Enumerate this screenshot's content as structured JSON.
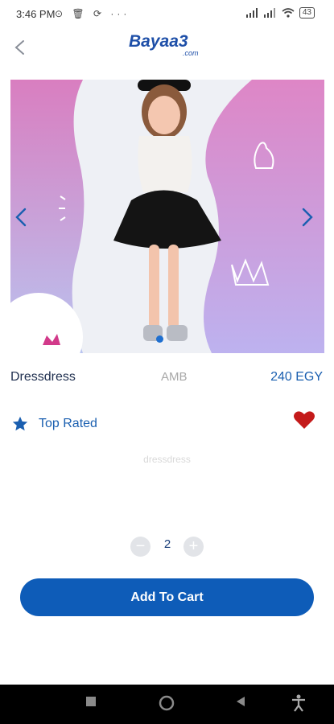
{
  "status": {
    "time": "3:46 PM",
    "left_icons": "⊙ 🗑 ⟳ ···",
    "battery": "43"
  },
  "header": {
    "logo_main": "Bayaa3",
    "logo_sub": ".com"
  },
  "product": {
    "name": "Dressdress",
    "brand": "AMB",
    "price": "240 EGY",
    "badge": "Top Rated",
    "description": "dressdress",
    "quantity": "2"
  },
  "actions": {
    "minus": "−",
    "plus": "+",
    "add_to_cart": "Add To Cart"
  },
  "colors": {
    "accent": "#0e5cb8",
    "heart": "#c41a1a",
    "hero_pink": "#d98ac6",
    "hero_lilac": "#b9b6f0"
  }
}
